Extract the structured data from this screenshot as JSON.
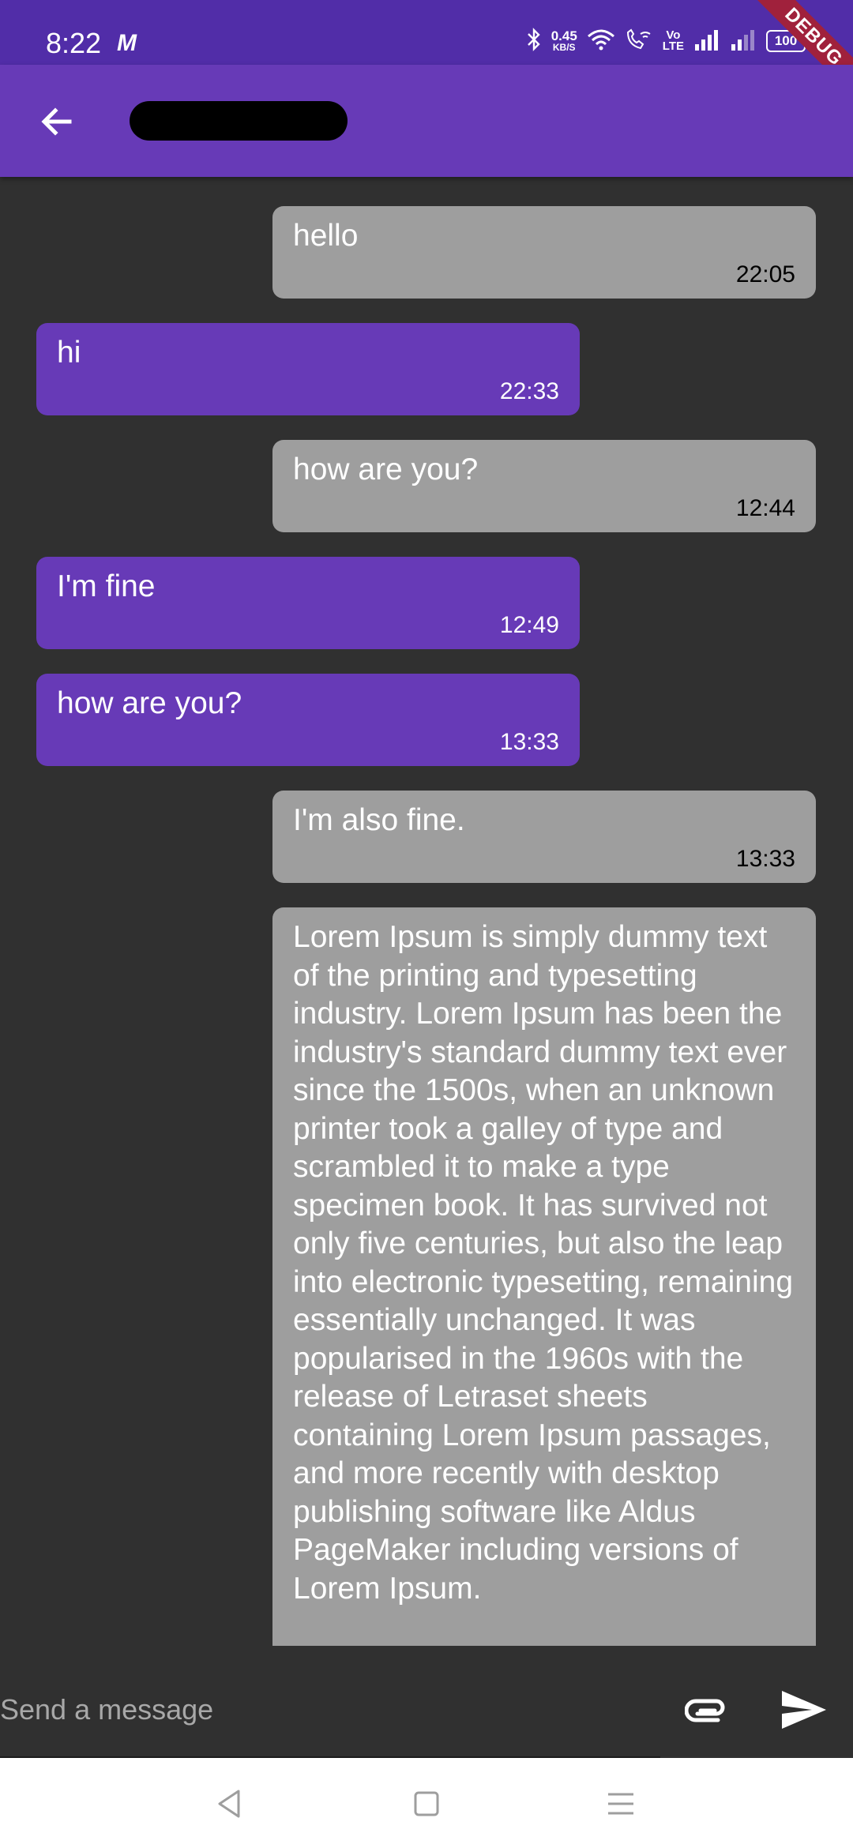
{
  "status_bar": {
    "time": "8:22",
    "carrier_icon": "M",
    "net_speed": "0.45",
    "net_unit": "KB/S",
    "volte_label": "Vo\nLTE",
    "battery": "100",
    "debug_banner": "DEBUG",
    "icons": [
      "bluetooth-icon",
      "wifi-icon",
      "wifi-calling-icon",
      "signal-icon",
      "signal-icon",
      "battery-icon"
    ]
  },
  "app_bar": {
    "back_icon": "arrow-back-icon",
    "contact_name": "",
    "color": "#673AB7"
  },
  "messages": [
    {
      "direction": "out",
      "text": "hello",
      "time": "22:05"
    },
    {
      "direction": "in",
      "text": "hi",
      "time": "22:33"
    },
    {
      "direction": "out",
      "text": "how are you?",
      "time": "12:44"
    },
    {
      "direction": "in",
      "text": "I'm fine",
      "time": "12:49"
    },
    {
      "direction": "in",
      "text": "how are you?",
      "time": "13:33"
    },
    {
      "direction": "out",
      "text": "I'm also fine.",
      "time": "13:33"
    },
    {
      "direction": "out",
      "text": "Lorem Ipsum is simply dummy text of the printing and typesetting industry. Lorem Ipsum has been the industry's standard dummy text ever since the 1500s, when an unknown printer took a galley of type and scrambled it to make a type specimen book. It has survived not only five centuries, but also the leap into electronic typesetting, remaining essentially unchanged. It was popularised in the 1960s with the release of Letraset sheets containing Lorem Ipsum passages, and more recently with desktop publishing software like Aldus PageMaker including versions of Lorem Ipsum.",
      "time": ""
    }
  ],
  "composer": {
    "placeholder": "Send a message",
    "value": "",
    "attach_icon": "paperclip-icon",
    "send_icon": "send-icon"
  },
  "nav_bar": {
    "icons": [
      "back-triangle-icon",
      "home-square-icon",
      "menu-lines-icon"
    ]
  },
  "colors": {
    "background": "#303030",
    "status_bar": "#512DA8",
    "incoming_bubble": "#673AB7",
    "outgoing_bubble": "#9E9E9E",
    "debug_ribbon": "#A0213C"
  }
}
